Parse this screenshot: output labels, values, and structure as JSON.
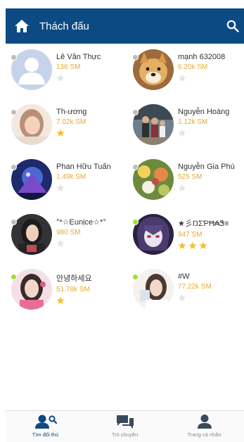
{
  "header": {
    "title": "Thách đấu",
    "home_icon": "home-icon",
    "search_icon": "search-icon"
  },
  "players": [
    {
      "name": "Lê Văn Thực",
      "score": "136 SM",
      "online": false,
      "stars": 0,
      "avatar": "default"
    },
    {
      "name": "mạnh 632008",
      "score": "6.20k SM",
      "online": false,
      "stars": 0,
      "avatar": "dog"
    },
    {
      "name": "Th-ương",
      "score": "7.02k SM",
      "online": false,
      "stars": 1,
      "avatar": "girl-light"
    },
    {
      "name": "Nguyễn Hoàng",
      "score": "1.12k SM",
      "online": false,
      "stars": 0,
      "avatar": "family"
    },
    {
      "name": "Phan Hữu Tuấn",
      "score": "1.49k SM",
      "online": false,
      "stars": 0,
      "avatar": "blue-art"
    },
    {
      "name": "Nguyễn Gia Phú",
      "score": "525 SM",
      "online": false,
      "stars": 0,
      "avatar": "flowers"
    },
    {
      "name": "°*☆Eunịce☆*°",
      "score": "980 SM",
      "online": false,
      "stars": 0,
      "avatar": "girl-dark"
    },
    {
      "name": "★彡ŊΣƤĦ₳Ꮥ≡",
      "score": "947 SM",
      "online": true,
      "stars": 3,
      "avatar": "anime"
    },
    {
      "name": "안녕하세요",
      "score": "51.78k SM",
      "online": true,
      "stars": 1,
      "avatar": "girl-pink"
    },
    {
      "name": "#W",
      "score": "77.22k SM",
      "online": true,
      "stars": 0,
      "avatar": "girl-white"
    }
  ],
  "bottom_nav": [
    {
      "label": "Tìm đối thủ",
      "icon": "find-opponent-icon",
      "active": true
    },
    {
      "label": "Trò chuyện",
      "icon": "chat-icon",
      "active": false
    },
    {
      "label": "Trang cá nhân",
      "icon": "profile-icon",
      "active": false
    }
  ],
  "colors": {
    "header": "#0b4a82",
    "score": "#e5a93a",
    "star_on": "#f2c230",
    "star_off": "#e3e3e3",
    "online": "#9be22b",
    "offline": "#bdbdbd"
  }
}
